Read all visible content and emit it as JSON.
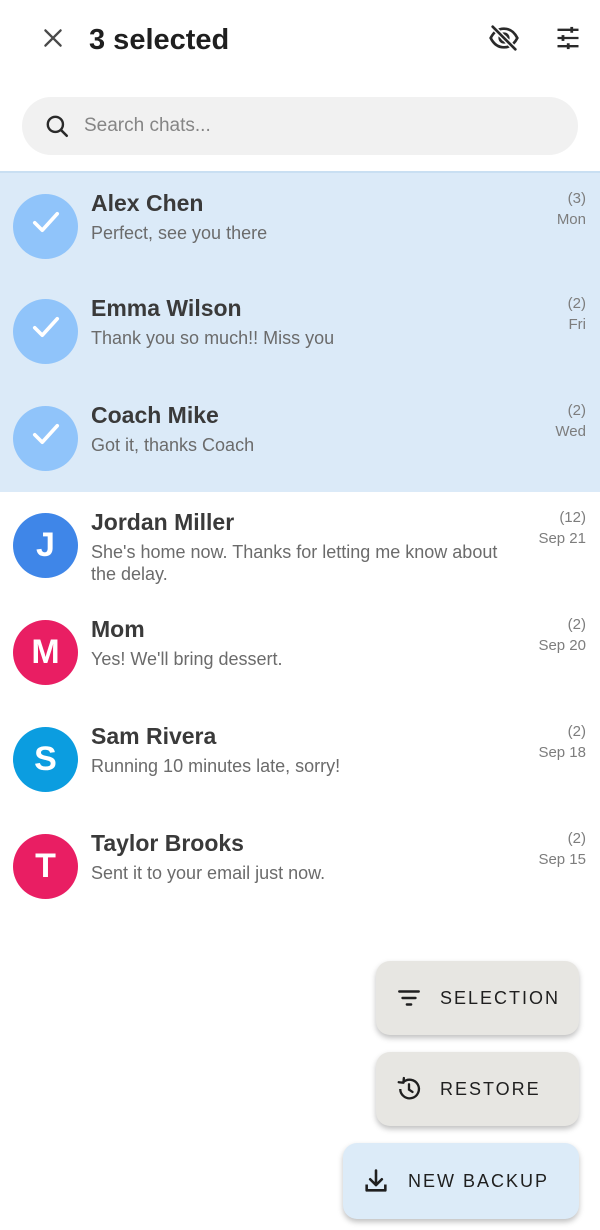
{
  "header": {
    "title": "3 selected",
    "close_icon": "close-icon",
    "hide_icon": "eye-off-icon",
    "filter_icon": "tune-icon"
  },
  "search": {
    "placeholder": "Search chats...",
    "value": "",
    "icon": "search-icon"
  },
  "chats": [
    {
      "name": "Alex Chen",
      "preview": "Perfect, see you there",
      "count": "(3)",
      "date": "Mon",
      "selected": true,
      "initial": "",
      "color": "#90c4fa"
    },
    {
      "name": "Emma Wilson",
      "preview": "Thank you so much!! Miss you",
      "count": "(2)",
      "date": "Fri",
      "selected": true,
      "initial": "",
      "color": "#90c4fa"
    },
    {
      "name": "Coach Mike",
      "preview": "Got it, thanks Coach",
      "count": "(2)",
      "date": "Wed",
      "selected": true,
      "initial": "",
      "color": "#90c4fa"
    },
    {
      "name": "Jordan Miller",
      "preview": "She's home now. Thanks for letting me know about the delay.",
      "count": "(12)",
      "date": "Sep 21",
      "selected": false,
      "initial": "J",
      "color": "#3f86e8"
    },
    {
      "name": "Mom",
      "preview": "Yes! We'll bring dessert.",
      "count": "(2)",
      "date": "Sep 20",
      "selected": false,
      "initial": "M",
      "color": "#e91e63"
    },
    {
      "name": "Sam Rivera",
      "preview": "Running 10 minutes late, sorry!",
      "count": "(2)",
      "date": "Sep 18",
      "selected": false,
      "initial": "S",
      "color": "#0b9de0"
    },
    {
      "name": "Taylor Brooks",
      "preview": "Sent it to your email just now.",
      "count": "(2)",
      "date": "Sep 15",
      "selected": false,
      "initial": "T",
      "color": "#e91e63"
    }
  ],
  "actions": {
    "selection_label": "SELECTION",
    "selection_icon": "filter-list-icon",
    "restore_label": "RESTORE",
    "restore_icon": "history-icon",
    "backup_label": "NEW BACKUP",
    "backup_icon": "download-icon"
  },
  "colors": {
    "selected_row": "#dbeaf8",
    "check_avatar": "#90c4fa",
    "fab_neutral": "#e7e6e2",
    "fab_primary": "#dcebf8"
  }
}
